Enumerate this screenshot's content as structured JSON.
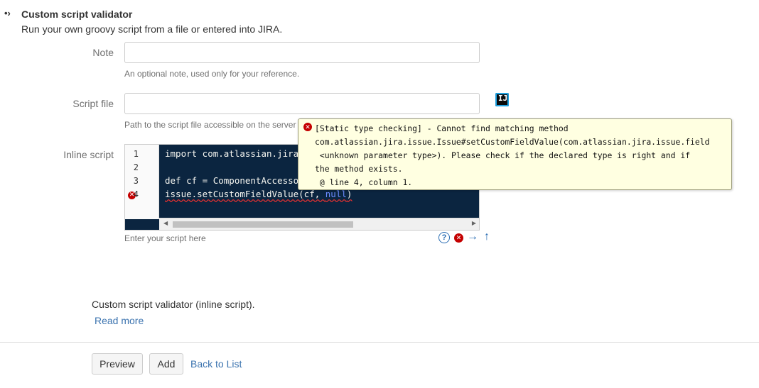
{
  "section": {
    "bullet": "•›",
    "title": "Custom script validator",
    "description": "Run your own groovy script from a file or entered into JIRA."
  },
  "note": {
    "label": "Note",
    "value": "",
    "hint": "An optional note, used only for your reference."
  },
  "script_file": {
    "label": "Script file",
    "value": "",
    "hint": "Path to the script file accessible on the server",
    "icon": "intellij-idea-icon"
  },
  "inline_script": {
    "label": "Inline script",
    "hint": "Enter your script here",
    "lines": [
      {
        "num": "1",
        "code": "import com.atlassian.jira"
      },
      {
        "num": "2",
        "code": ""
      },
      {
        "num": "3",
        "code": "def cf = ComponentAccesso"
      },
      {
        "num": "4",
        "code_pre": "issue.setCustomFieldValue(cf, ",
        "code_null": "null",
        "code_post": ")"
      }
    ],
    "error_line": "4"
  },
  "tooltip": {
    "message": "[Static type checking] - Cannot find matching method\ncom.atlassian.jira.issue.Issue#setCustomFieldValue(com.atlassian.jira.issue.field\n <unknown parameter type>). Please check if the declared type is right and if\nthe method exists.\n @ line 4, column 1."
  },
  "editor_tools": [
    "help-icon",
    "error-icon",
    "arrow-right-icon",
    "arrow-up-icon"
  ],
  "summary": {
    "text": "Custom script validator (inline script).",
    "read_more": "Read more"
  },
  "actions": {
    "preview": "Preview",
    "add": "Add",
    "back": "Back to List"
  },
  "colors": {
    "link": "#3b73af",
    "editor_bg": "#0b2540",
    "error": "#c40000",
    "tooltip_bg": "#ffffe1"
  }
}
